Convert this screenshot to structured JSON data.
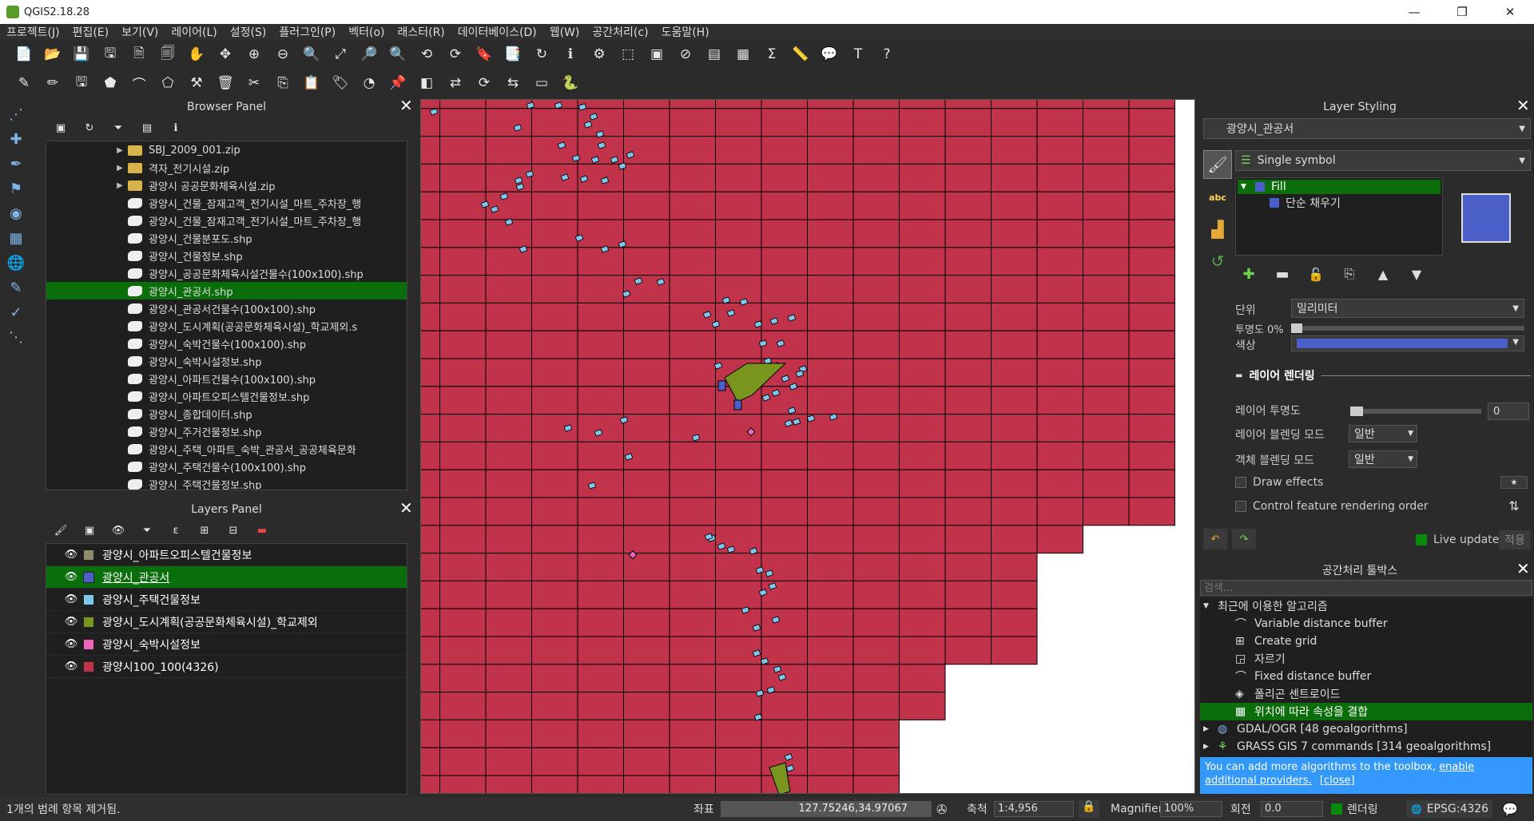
{
  "window": {
    "title": "QGIS2.18.28"
  },
  "menu": [
    "프로젝트(J)",
    "편집(E)",
    "보기(V)",
    "레이어(L)",
    "설정(S)",
    "플러그인(P)",
    "벡터(o)",
    "래스터(R)",
    "데이터베이스(D)",
    "웹(W)",
    "공간처리(c)",
    "도움말(H)"
  ],
  "browser": {
    "title": "Browser Panel",
    "items": [
      {
        "label": "SBJ_2009_001.zip",
        "kind": "folder",
        "expand": true
      },
      {
        "label": "격자_전기시설.zip",
        "kind": "folder",
        "expand": true
      },
      {
        "label": "광양시 공공문화체육시설.zip",
        "kind": "folder",
        "expand": true
      },
      {
        "label": "광양시_건물_잠재고객_전기시설_마트_주차장_행",
        "kind": "shp"
      },
      {
        "label": "광양시_건물_잠재고객_전기시설_마트_주차장_행",
        "kind": "shp"
      },
      {
        "label": "광양시_건물분포도.shp",
        "kind": "shp"
      },
      {
        "label": "광양시_건물정보.shp",
        "kind": "shp"
      },
      {
        "label": "광양시_공공문화체육시설건물수(100x100).shp",
        "kind": "shp"
      },
      {
        "label": "광양시_관공서.shp",
        "kind": "shp",
        "selected": true
      },
      {
        "label": "광양시_관공서건물수(100x100).shp",
        "kind": "shp"
      },
      {
        "label": "광양시_도시계획(공공문화체육시설)_학교제외.s",
        "kind": "shp"
      },
      {
        "label": "광양시_숙박건물수(100x100).shp",
        "kind": "shp"
      },
      {
        "label": "광양시_숙박시설정보.shp",
        "kind": "shp"
      },
      {
        "label": "광양시_아파트건물수(100x100).shp",
        "kind": "shp"
      },
      {
        "label": "광양시_아파트오피스텔건물정보.shp",
        "kind": "shp"
      },
      {
        "label": "광양시_종합데이터.shp",
        "kind": "shp"
      },
      {
        "label": "광양시_주거건물정보.shp",
        "kind": "shp"
      },
      {
        "label": "광양시_주택_아파트_숙박_관공서_공공체육문화",
        "kind": "shp"
      },
      {
        "label": "광양시_주택건물수(100x100).shp",
        "kind": "shp"
      },
      {
        "label": "광양시_주택건물정보.shp",
        "kind": "shp"
      }
    ]
  },
  "layers": {
    "title": "Layers Panel",
    "items": [
      {
        "label": "광양시_아파트오피스텔건물정보",
        "color": "#8f8a6a"
      },
      {
        "label": "광양시_관공서",
        "color": "#4a5fc8",
        "selected": true
      },
      {
        "label": "광양시_주택건물정보",
        "color": "#7ec8ee"
      },
      {
        "label": "광양시_도시계획(공공문화체육시설)_학교제외",
        "color": "#78951e"
      },
      {
        "label": "광양시_숙박시설정보",
        "color": "#ee66bb"
      },
      {
        "label": "광양시100_100(4326)",
        "color": "#c0334a"
      }
    ]
  },
  "styling": {
    "title": "Layer Styling",
    "layer": "광양시_관공서",
    "renderer": "Single symbol",
    "tree_fill": "Fill",
    "tree_sub": "단순 채우기",
    "unit_label": "단위",
    "unit_value": "밀리미터",
    "opacity_label": "투명도 0%",
    "color_label": "색상",
    "color": "#4a5fc8",
    "section": "레이어 렌더링",
    "layer_opacity_label": "레이어 투명도",
    "layer_opacity_value": "0",
    "blend_label": "레이어 블렌딩 모드",
    "blend_value": "일반",
    "feature_blend_label": "객체 블렌딩 모드",
    "feature_blend_value": "일반",
    "draw_effects": "Draw effects",
    "control_order": "Control feature rendering order",
    "live_update": "Live update",
    "apply": "적용"
  },
  "toolbox": {
    "title": "공간처리 툴박스",
    "search_placeholder": "검색...",
    "recent": "최근에 이용한 알고리즘",
    "algorithms": [
      "Variable distance buffer",
      "Create grid",
      "자르기",
      "Fixed distance buffer",
      "폴리곤 센트로이드",
      "위치에 따라 속성을 결합"
    ],
    "groups": [
      "GDAL/OGR [48 geoalgorithms]",
      "GRASS GIS 7 commands [314 geoalgorithms]"
    ],
    "info_text": "You can add more algorithms to the toolbox, ",
    "info_link": "enable additional providers.",
    "info_close": "[close]"
  },
  "status": {
    "message": "1개의 범례 항목 제거됨.",
    "coord_label": "좌표",
    "coord_value": "127.75246,34.97067",
    "scale_label": "축척",
    "scale_value": "1:4,956",
    "magnifier_label": "Magnifier",
    "magnifier_value": "100%",
    "rotation_label": "회전",
    "rotation_value": "0.0",
    "render_label": "렌더링",
    "crs": "EPSG:4326"
  },
  "colors": {
    "grid_fill": "#c0334a",
    "accent_green": "#0a6e0a"
  }
}
